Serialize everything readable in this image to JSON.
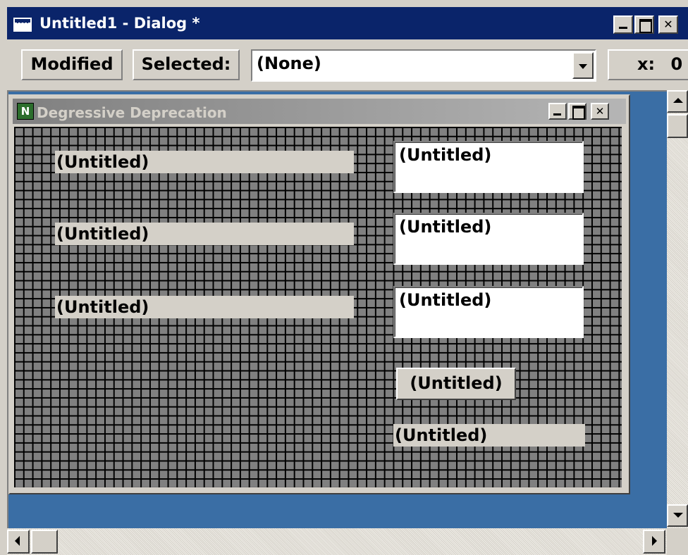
{
  "window": {
    "title": "Untitled1 - Dialog *",
    "minimize": "",
    "maximize": "",
    "close": "✕"
  },
  "toolbar": {
    "modified_label": "Modified",
    "selected_label": "Selected:",
    "selected_value": "(None)",
    "coord_label": "x:",
    "coord_value": "0"
  },
  "dialog": {
    "title": "Degressive Deprecation",
    "icon_letter": "N",
    "close": "✕",
    "static_labels": [
      "(Untitled)",
      "(Untitled)",
      "(Untitled)"
    ],
    "edit_fields": [
      "(Untitled)",
      "(Untitled)",
      "(Untitled)"
    ],
    "button_label": "(Untitled)",
    "bottom_label": "(Untitled)"
  },
  "colors": {
    "title_active": "#0a246a",
    "title_inactive": "#808080",
    "workspace": "#3a6ea5",
    "face": "#d4d0c8",
    "grid": "#808080"
  }
}
